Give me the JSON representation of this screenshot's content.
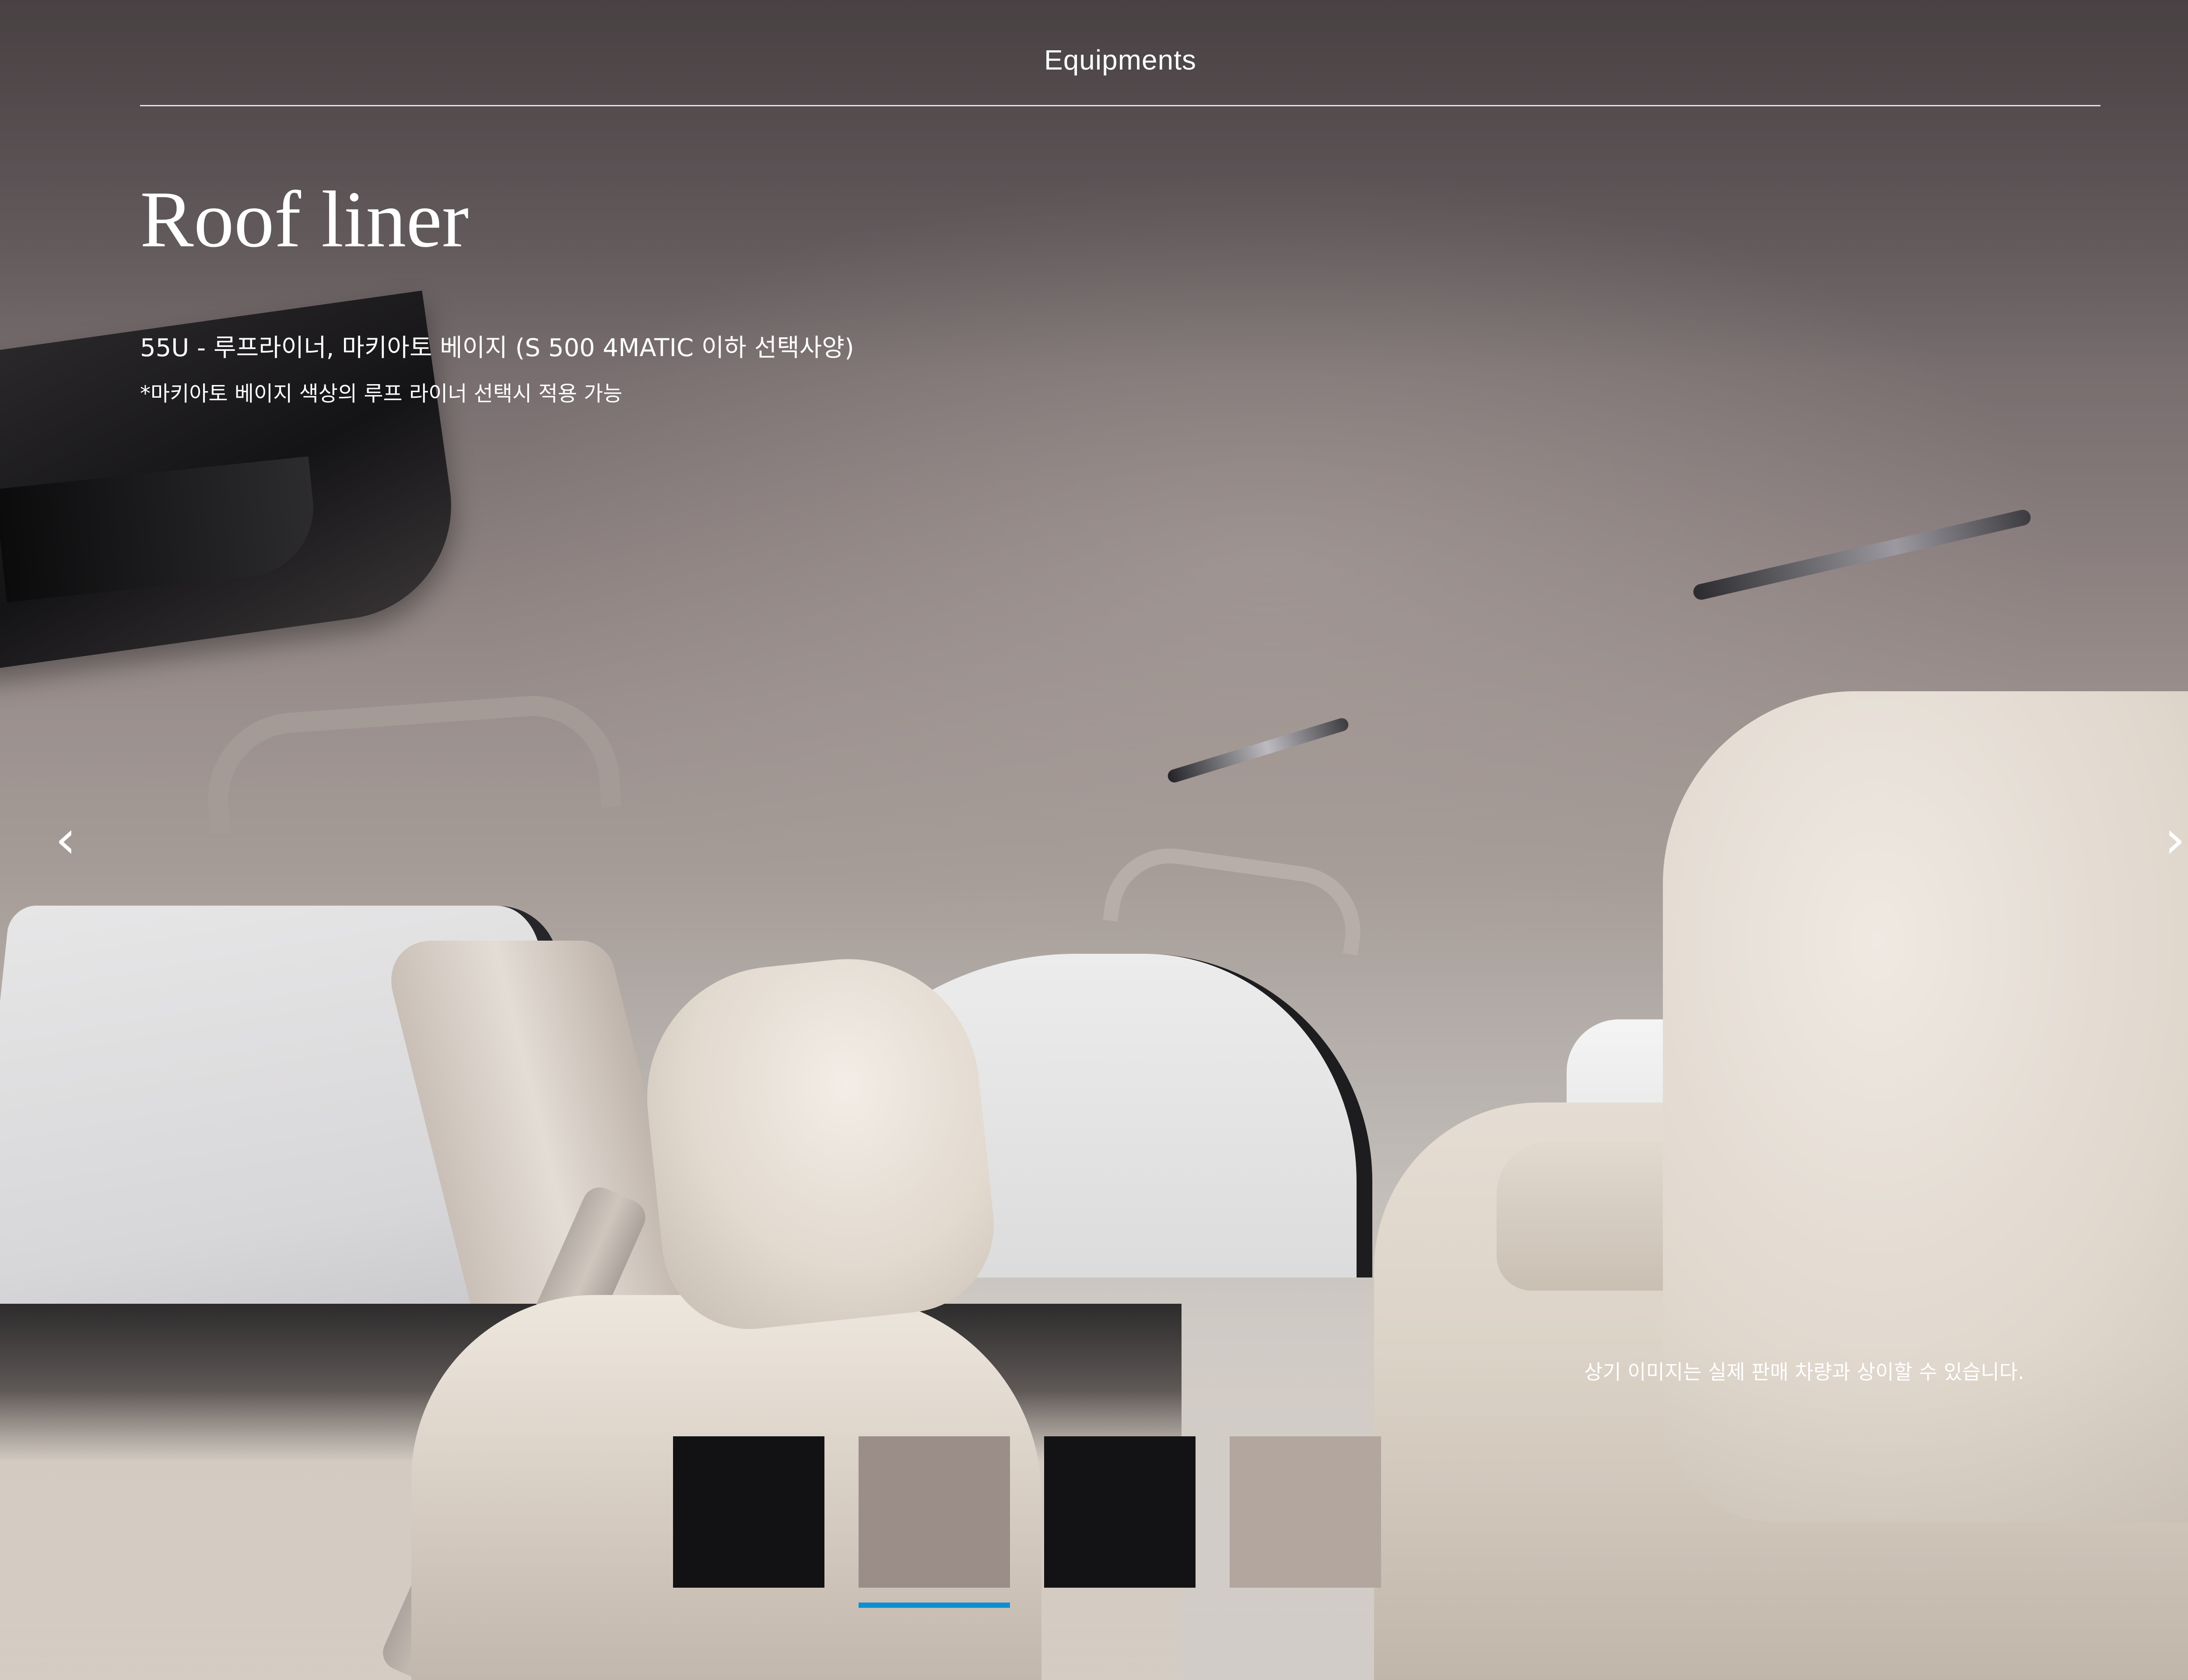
{
  "header": {
    "title": "Equipments"
  },
  "section": {
    "title": "Roof liner",
    "option_description": "55U - 루프라이너, 마키아토 베이지 (S 500 4MATIC 이하 선택사양)",
    "note": "*마키아토 베이지 색상의 루프 라이너 선택시 적용 가능"
  },
  "navigation": {
    "prev_icon": "‹",
    "next_icon": "›"
  },
  "disclaimer": "상기 이미지는 실제 판매 차량과 상이할 수 있습니다.",
  "swatches": {
    "selected_index": 1,
    "items": [
      {
        "color": "#121214"
      },
      {
        "color": "#9b8e88"
      },
      {
        "color": "#131315"
      },
      {
        "color": "#b3a69f"
      }
    ],
    "indicator_color": "#0d8fd6"
  }
}
